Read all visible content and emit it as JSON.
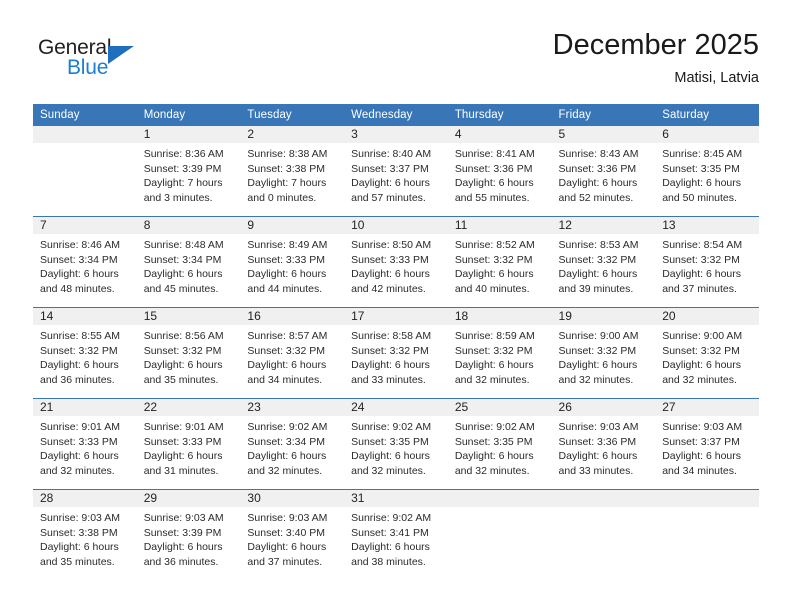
{
  "brand": {
    "name_part1": "General",
    "name_part2": "Blue",
    "triangle_color": "#1f6fbd",
    "blue_color": "#1b7fd4"
  },
  "header": {
    "title": "December 2025",
    "subtitle": "Matisi, Latvia"
  },
  "theme": {
    "header_row_bg": "#3876b8",
    "header_row_text": "#ffffff",
    "daynum_bg": "#f0f0f0",
    "separator": "#3876b8",
    "body_text": "#2b2b2b"
  },
  "weekday_headers": [
    "Sunday",
    "Monday",
    "Tuesday",
    "Wednesday",
    "Thursday",
    "Friday",
    "Saturday"
  ],
  "weeks": [
    [
      {
        "day": "",
        "blank": true,
        "sunrise": "",
        "sunset": "",
        "daylight1": "",
        "daylight2": ""
      },
      {
        "day": "1",
        "sunrise": "Sunrise: 8:36 AM",
        "sunset": "Sunset: 3:39 PM",
        "daylight1": "Daylight: 7 hours",
        "daylight2": "and 3 minutes."
      },
      {
        "day": "2",
        "sunrise": "Sunrise: 8:38 AM",
        "sunset": "Sunset: 3:38 PM",
        "daylight1": "Daylight: 7 hours",
        "daylight2": "and 0 minutes."
      },
      {
        "day": "3",
        "sunrise": "Sunrise: 8:40 AM",
        "sunset": "Sunset: 3:37 PM",
        "daylight1": "Daylight: 6 hours",
        "daylight2": "and 57 minutes."
      },
      {
        "day": "4",
        "sunrise": "Sunrise: 8:41 AM",
        "sunset": "Sunset: 3:36 PM",
        "daylight1": "Daylight: 6 hours",
        "daylight2": "and 55 minutes."
      },
      {
        "day": "5",
        "sunrise": "Sunrise: 8:43 AM",
        "sunset": "Sunset: 3:36 PM",
        "daylight1": "Daylight: 6 hours",
        "daylight2": "and 52 minutes."
      },
      {
        "day": "6",
        "sunrise": "Sunrise: 8:45 AM",
        "sunset": "Sunset: 3:35 PM",
        "daylight1": "Daylight: 6 hours",
        "daylight2": "and 50 minutes."
      }
    ],
    [
      {
        "day": "7",
        "sunrise": "Sunrise: 8:46 AM",
        "sunset": "Sunset: 3:34 PM",
        "daylight1": "Daylight: 6 hours",
        "daylight2": "and 48 minutes."
      },
      {
        "day": "8",
        "sunrise": "Sunrise: 8:48 AM",
        "sunset": "Sunset: 3:34 PM",
        "daylight1": "Daylight: 6 hours",
        "daylight2": "and 45 minutes."
      },
      {
        "day": "9",
        "sunrise": "Sunrise: 8:49 AM",
        "sunset": "Sunset: 3:33 PM",
        "daylight1": "Daylight: 6 hours",
        "daylight2": "and 44 minutes."
      },
      {
        "day": "10",
        "sunrise": "Sunrise: 8:50 AM",
        "sunset": "Sunset: 3:33 PM",
        "daylight1": "Daylight: 6 hours",
        "daylight2": "and 42 minutes."
      },
      {
        "day": "11",
        "sunrise": "Sunrise: 8:52 AM",
        "sunset": "Sunset: 3:32 PM",
        "daylight1": "Daylight: 6 hours",
        "daylight2": "and 40 minutes."
      },
      {
        "day": "12",
        "sunrise": "Sunrise: 8:53 AM",
        "sunset": "Sunset: 3:32 PM",
        "daylight1": "Daylight: 6 hours",
        "daylight2": "and 39 minutes."
      },
      {
        "day": "13",
        "sunrise": "Sunrise: 8:54 AM",
        "sunset": "Sunset: 3:32 PM",
        "daylight1": "Daylight: 6 hours",
        "daylight2": "and 37 minutes."
      }
    ],
    [
      {
        "day": "14",
        "sunrise": "Sunrise: 8:55 AM",
        "sunset": "Sunset: 3:32 PM",
        "daylight1": "Daylight: 6 hours",
        "daylight2": "and 36 minutes."
      },
      {
        "day": "15",
        "sunrise": "Sunrise: 8:56 AM",
        "sunset": "Sunset: 3:32 PM",
        "daylight1": "Daylight: 6 hours",
        "daylight2": "and 35 minutes."
      },
      {
        "day": "16",
        "sunrise": "Sunrise: 8:57 AM",
        "sunset": "Sunset: 3:32 PM",
        "daylight1": "Daylight: 6 hours",
        "daylight2": "and 34 minutes."
      },
      {
        "day": "17",
        "sunrise": "Sunrise: 8:58 AM",
        "sunset": "Sunset: 3:32 PM",
        "daylight1": "Daylight: 6 hours",
        "daylight2": "and 33 minutes."
      },
      {
        "day": "18",
        "sunrise": "Sunrise: 8:59 AM",
        "sunset": "Sunset: 3:32 PM",
        "daylight1": "Daylight: 6 hours",
        "daylight2": "and 32 minutes."
      },
      {
        "day": "19",
        "sunrise": "Sunrise: 9:00 AM",
        "sunset": "Sunset: 3:32 PM",
        "daylight1": "Daylight: 6 hours",
        "daylight2": "and 32 minutes."
      },
      {
        "day": "20",
        "sunrise": "Sunrise: 9:00 AM",
        "sunset": "Sunset: 3:32 PM",
        "daylight1": "Daylight: 6 hours",
        "daylight2": "and 32 minutes."
      }
    ],
    [
      {
        "day": "21",
        "sunrise": "Sunrise: 9:01 AM",
        "sunset": "Sunset: 3:33 PM",
        "daylight1": "Daylight: 6 hours",
        "daylight2": "and 32 minutes."
      },
      {
        "day": "22",
        "sunrise": "Sunrise: 9:01 AM",
        "sunset": "Sunset: 3:33 PM",
        "daylight1": "Daylight: 6 hours",
        "daylight2": "and 31 minutes."
      },
      {
        "day": "23",
        "sunrise": "Sunrise: 9:02 AM",
        "sunset": "Sunset: 3:34 PM",
        "daylight1": "Daylight: 6 hours",
        "daylight2": "and 32 minutes."
      },
      {
        "day": "24",
        "sunrise": "Sunrise: 9:02 AM",
        "sunset": "Sunset: 3:35 PM",
        "daylight1": "Daylight: 6 hours",
        "daylight2": "and 32 minutes."
      },
      {
        "day": "25",
        "sunrise": "Sunrise: 9:02 AM",
        "sunset": "Sunset: 3:35 PM",
        "daylight1": "Daylight: 6 hours",
        "daylight2": "and 32 minutes."
      },
      {
        "day": "26",
        "sunrise": "Sunrise: 9:03 AM",
        "sunset": "Sunset: 3:36 PM",
        "daylight1": "Daylight: 6 hours",
        "daylight2": "and 33 minutes."
      },
      {
        "day": "27",
        "sunrise": "Sunrise: 9:03 AM",
        "sunset": "Sunset: 3:37 PM",
        "daylight1": "Daylight: 6 hours",
        "daylight2": "and 34 minutes."
      }
    ],
    [
      {
        "day": "28",
        "sunrise": "Sunrise: 9:03 AM",
        "sunset": "Sunset: 3:38 PM",
        "daylight1": "Daylight: 6 hours",
        "daylight2": "and 35 minutes."
      },
      {
        "day": "29",
        "sunrise": "Sunrise: 9:03 AM",
        "sunset": "Sunset: 3:39 PM",
        "daylight1": "Daylight: 6 hours",
        "daylight2": "and 36 minutes."
      },
      {
        "day": "30",
        "sunrise": "Sunrise: 9:03 AM",
        "sunset": "Sunset: 3:40 PM",
        "daylight1": "Daylight: 6 hours",
        "daylight2": "and 37 minutes."
      },
      {
        "day": "31",
        "sunrise": "Sunrise: 9:02 AM",
        "sunset": "Sunset: 3:41 PM",
        "daylight1": "Daylight: 6 hours",
        "daylight2": "and 38 minutes."
      },
      {
        "day": "",
        "blank": true,
        "sunrise": "",
        "sunset": "",
        "daylight1": "",
        "daylight2": ""
      },
      {
        "day": "",
        "blank": true,
        "sunrise": "",
        "sunset": "",
        "daylight1": "",
        "daylight2": ""
      },
      {
        "day": "",
        "blank": true,
        "sunrise": "",
        "sunset": "",
        "daylight1": "",
        "daylight2": ""
      }
    ]
  ]
}
